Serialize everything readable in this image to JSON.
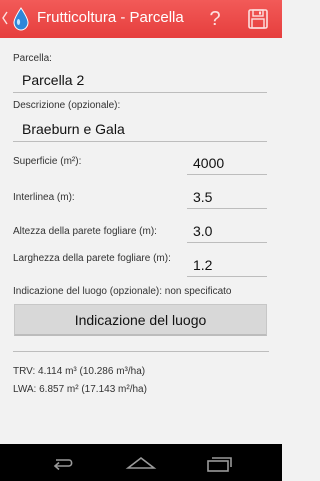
{
  "actionbar": {
    "title": "Frutticoltura - Parcella",
    "help_label": "?",
    "brand_color": "#e8403f"
  },
  "form": {
    "parcel_label": "Parcella:",
    "parcel_value": "Parcella 2",
    "description_label": "Descrizione (opzionale):",
    "description_value": "Braeburn e Gala",
    "area_label": "Superficie (m²):",
    "area_value": "4000",
    "row_spacing_label": "Interlinea (m):",
    "row_spacing_value": "3.5",
    "wall_height_label": "Altezza della parete fogliare (m):",
    "wall_height_value": "3.0",
    "wall_width_label": "Larghezza della parete fogliare (m):",
    "wall_width_value": "1.2",
    "location_status": "Indicazione del luogo (opzionale): non specificato",
    "location_button": "Indicazione del luogo"
  },
  "results": {
    "trv": "TRV: 4.114 m³ (10.286 m³/ha)",
    "lwa": "LWA: 6.857 m² (17.143 m²/ha)"
  },
  "icons": {
    "up": "chevron-left-icon",
    "app": "water-drop-icon",
    "help": "question-icon",
    "save": "floppy-disk-icon",
    "nav_back": "back-icon",
    "nav_home": "home-icon",
    "nav_recents": "recents-icon"
  }
}
